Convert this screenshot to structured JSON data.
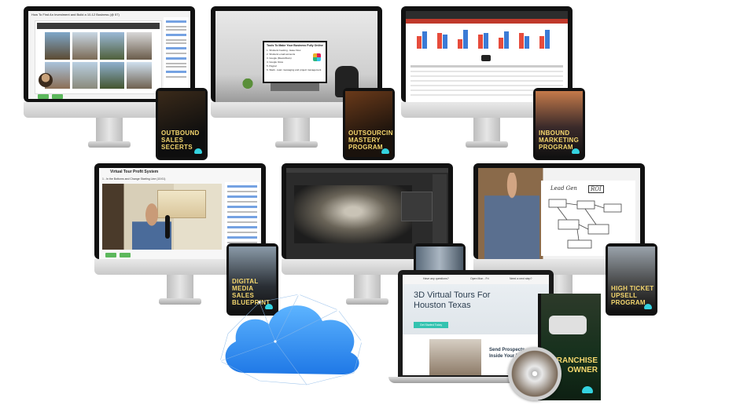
{
  "screens": {
    "top_left": {
      "title": "How To Find An Investment and Build a 10-12 Business (@ 57)"
    },
    "top_center": {
      "sign_title": "Tools To Make Your Business Fully Online",
      "sign_items": [
        "1. Shutterst booking - Ease Flow",
        "2. Shutterst email accounts",
        "3. Google (Meets/Docs)",
        "4. Google Voice",
        "5. Paypal",
        "6. Slack - team messaging and project management"
      ]
    },
    "mid_left": {
      "title": "Virtual Tour Profit System",
      "subtitle": "1 - In the Bottoms and Change Starting Line (10:01)"
    },
    "mid_right": {
      "whiteboard_words": [
        "Lead Gen",
        "ROI"
      ]
    }
  },
  "tablets": {
    "outbound": "OUTBOUND\nSALES\nSECERTS",
    "outsourcing": "OUTSOURCING\nMASTERY\nPROGRAM",
    "inbound": "INBOUND\nMARKETING\nPROGRAM",
    "digital": "DIGITAL\nMEDIA\nSALES\nBLUEPRINT",
    "hightick": "HIGH TICKET\nUPSELL\nPROGRAM"
  },
  "laptop": {
    "top_items": [
      "Have any questions?",
      "Open Mon - Fri",
      "Need a next step?"
    ],
    "headline": "3D Virtual Tours For Houston Texas",
    "cta": "Get Started Today",
    "sub_headline": "Send Prospects Inside Your Business"
  },
  "book": {
    "title": "FRANCHISE\nOWNER"
  },
  "colors": {
    "cloud": "#2b8ff0",
    "tablet_text": "#f5d76e",
    "accent_teal": "#34d3e0"
  }
}
